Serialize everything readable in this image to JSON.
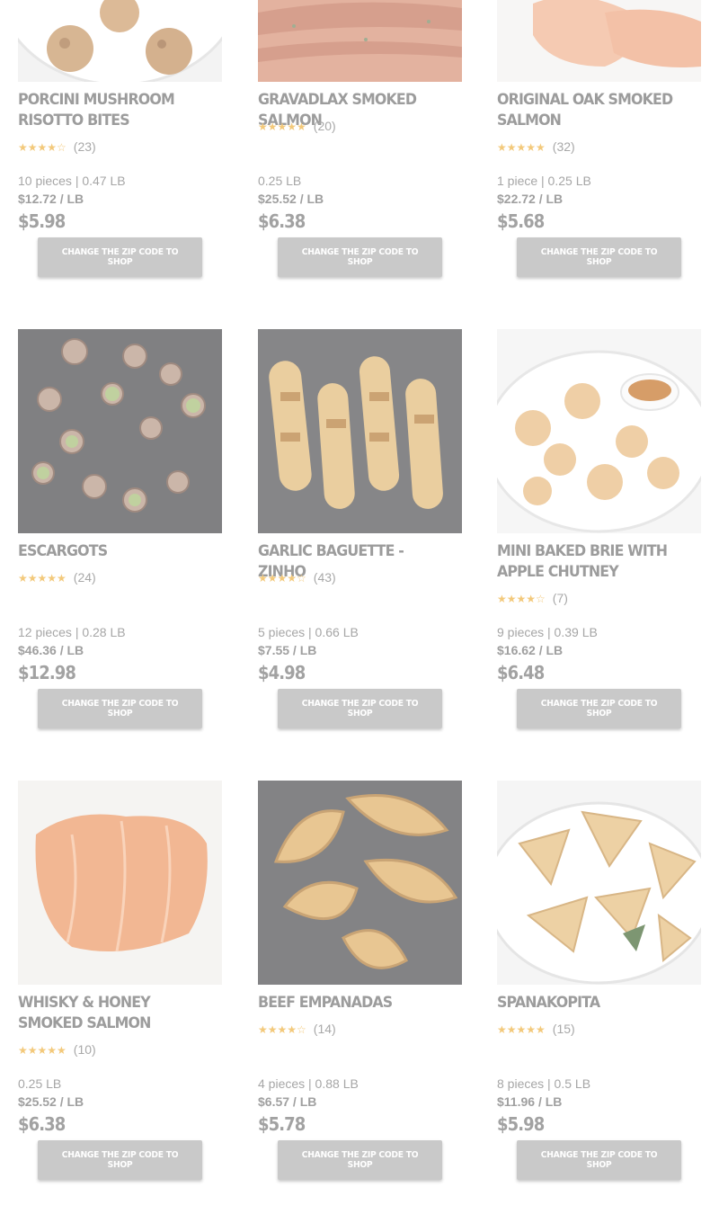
{
  "colors": {
    "title": "#9c9c9c",
    "stars": "#f3c97b",
    "button_bg": "#c9c9c9",
    "button_text": "#ffffff"
  },
  "products": [
    {
      "name": "Porcini Mushroom Risotto Bites",
      "stars": "★★★★☆",
      "rating": 4,
      "reviews": "(23)",
      "weight": "10 pieces | 0.47 LB",
      "unit_price": "$12.72 / LB",
      "price": "$5.98",
      "button": "Change the zip code to shop",
      "image": "risotto-bites-photo"
    },
    {
      "name": "Gravadlax Smoked Salmon",
      "stars": "★★★★★",
      "rating": 5,
      "reviews": "(20)",
      "weight": "0.25 LB",
      "unit_price": "$25.52 / LB",
      "price": "$6.38",
      "button": "Change the zip code to shop",
      "image": "gravadlax-photo"
    },
    {
      "name": "Original Oak Smoked Salmon",
      "stars": "★★★★★",
      "rating": 5,
      "reviews": "(32)",
      "weight": "1 piece | 0.25 LB",
      "unit_price": "$22.72 / LB",
      "price": "$5.68",
      "button": "Change the zip code to shop",
      "image": "oak-salmon-photo"
    },
    {
      "name": "Escargots",
      "stars": "★★★★★",
      "rating": 5,
      "reviews": "(24)",
      "weight": "12 pieces | 0.28 LB",
      "unit_price": "$46.36 / LB",
      "price": "$12.98",
      "button": "Change the zip code to shop",
      "image": "escargots-photo"
    },
    {
      "name": "Garlic Baguette - Zinho",
      "stars": "★★★★☆",
      "rating": 4.5,
      "reviews": "(43)",
      "weight": "5 pieces | 0.66 LB",
      "unit_price": "$7.55 / LB",
      "price": "$4.98",
      "button": "Change the zip code to shop",
      "image": "garlic-baguette-photo"
    },
    {
      "name": "Mini Baked Brie with Apple Chutney",
      "stars": "★★★★☆",
      "rating": 4,
      "reviews": "(7)",
      "weight": "9 pieces | 0.39 LB",
      "unit_price": "$16.62 / LB",
      "price": "$6.48",
      "button": "Change the zip code to shop",
      "image": "baked-brie-photo"
    },
    {
      "name": "Whisky & Honey Smoked Salmon",
      "stars": "★★★★★",
      "rating": 5,
      "reviews": "(10)",
      "weight": "0.25 LB",
      "unit_price": "$25.52 / LB",
      "price": "$6.38",
      "button": "Change the zip code to shop",
      "image": "whisky-salmon-photo"
    },
    {
      "name": "Beef Empanadas",
      "stars": "★★★★☆",
      "rating": 4.5,
      "reviews": "(14)",
      "weight": "4 pieces | 0.88 LB",
      "unit_price": "$6.57 / LB",
      "price": "$5.78",
      "button": "Change the zip code to shop",
      "image": "empanadas-photo"
    },
    {
      "name": "Spanakopita",
      "stars": "★★★★★",
      "rating": 5,
      "reviews": "(15)",
      "weight": "8 pieces | 0.5 LB",
      "unit_price": "$11.96 / LB",
      "price": "$5.98",
      "button": "Change the zip code to shop",
      "image": "spanakopita-photo"
    }
  ]
}
